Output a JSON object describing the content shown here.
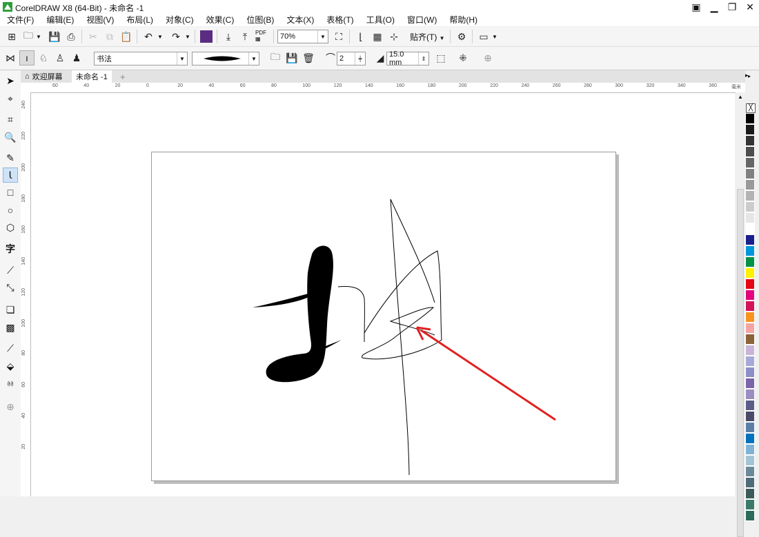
{
  "window": {
    "title": "CorelDRAW X8 (64-Bit) - 未命名 -1"
  },
  "menu": [
    "文件(F)",
    "编辑(E)",
    "视图(V)",
    "布局(L)",
    "对象(C)",
    "效果(C)",
    "位图(B)",
    "文本(X)",
    "表格(T)",
    "工具(O)",
    "窗口(W)",
    "帮助(H)"
  ],
  "toolbar": {
    "zoom": "70%",
    "snap_label": "贴齐(T)",
    "pdf_label": "PDF"
  },
  "propbar": {
    "artistic_style": "书法",
    "smoothing": "2",
    "width": "15.0 mm"
  },
  "tabs": {
    "welcome": "欢迎屏幕",
    "doc": "未命名 -1",
    "add": "+"
  },
  "ruler": {
    "h_labels": [
      "60",
      "40",
      "20",
      "0",
      "20",
      "40",
      "60",
      "80",
      "100",
      "120",
      "140",
      "160",
      "180",
      "200",
      "220",
      "240",
      "260",
      "280",
      "300",
      "320",
      "340",
      "360"
    ],
    "h_unit": "毫米",
    "v_labels": [
      "240",
      "220",
      "200",
      "180",
      "160",
      "140",
      "120",
      "100",
      "80",
      "60",
      "40",
      "20"
    ]
  },
  "palette_colors": [
    "#000000",
    "#1a1a1a",
    "#333333",
    "#4d4d4d",
    "#666666",
    "#808080",
    "#999999",
    "#b3b3b3",
    "#cccccc",
    "#e6e6e6",
    "#ffffff",
    "#1b1f8c",
    "#0096db",
    "#009245",
    "#fff200",
    "#e30613",
    "#e4007f",
    "#d4145a",
    "#f7931e",
    "#f5a3a3",
    "#8c6239",
    "#c9b3d9",
    "#a7a9d9",
    "#8c8fc8",
    "#7b64aa",
    "#9b8dbf",
    "#5c5c8a",
    "#4a4a6a",
    "#5b7fa6",
    "#0071bc",
    "#7fb3d5",
    "#a3c4d4",
    "#6a8a9a",
    "#4f6a78",
    "#3d5a5a",
    "#3b7a6a",
    "#2e6a5a"
  ],
  "accent": {
    "arrow": "#e02020"
  }
}
